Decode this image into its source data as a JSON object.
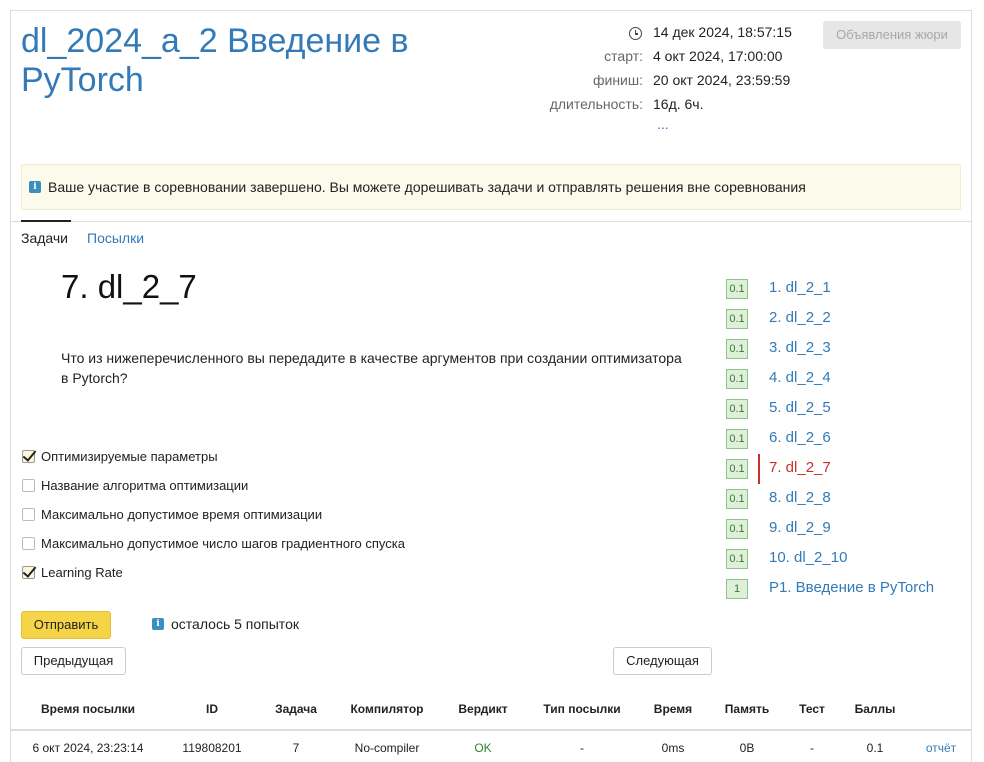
{
  "header": {
    "title": "dl_2024_a_2 Введение в PyTorch",
    "jury_button": "Объявления жюри",
    "meta": {
      "current_time": "14 дек 2024, 18:57:15",
      "start_label": "старт:",
      "start_value": "4 окт 2024, 17:00:00",
      "finish_label": "финиш:",
      "finish_value": "20 окт 2024, 23:59:59",
      "duration_label": "длительность:",
      "duration_value": "16д. 6ч.",
      "more": "..."
    }
  },
  "alert": {
    "text": "Ваше участие в соревновании завершено. Вы можете дорешивать задачи и отправлять решения вне соревнования"
  },
  "tabs": [
    {
      "label": "Задачи",
      "active": true
    },
    {
      "label": "Посылки",
      "active": false
    }
  ],
  "problem": {
    "title": "7. dl_2_7",
    "statement": "Что из нижеперечисленного вы передадите в качестве аргументов при создании оптимизатора в Pytorch?",
    "options": [
      {
        "label": "Оптимизируемые параметры",
        "checked": true
      },
      {
        "label": "Название алгоритма оптимизации",
        "checked": false
      },
      {
        "label": "Максимально допустимое время оптимизации",
        "checked": false
      },
      {
        "label": "Максимально допустимое число шагов градиентного спуска",
        "checked": false
      },
      {
        "label": "Learning Rate",
        "checked": true
      }
    ],
    "submit_label": "Отправить",
    "attempts_text": "осталось 5 попыток",
    "prev_label": "Предыдущая",
    "next_label": "Следующая"
  },
  "task_list": [
    {
      "score": "0.1",
      "label": "1. dl_2_1",
      "active": false
    },
    {
      "score": "0.1",
      "label": "2. dl_2_2",
      "active": false
    },
    {
      "score": "0.1",
      "label": "3. dl_2_3",
      "active": false
    },
    {
      "score": "0.1",
      "label": "4. dl_2_4",
      "active": false
    },
    {
      "score": "0.1",
      "label": "5. dl_2_5",
      "active": false
    },
    {
      "score": "0.1",
      "label": "6. dl_2_6",
      "active": false
    },
    {
      "score": "0.1",
      "label": "7. dl_2_7",
      "active": true
    },
    {
      "score": "0.1",
      "label": "8. dl_2_8",
      "active": false
    },
    {
      "score": "0.1",
      "label": "9. dl_2_9",
      "active": false
    },
    {
      "score": "0.1",
      "label": "10. dl_2_10",
      "active": false
    },
    {
      "score": "1",
      "label": "P1. Введение в PyTorch",
      "active": false
    }
  ],
  "submissions": {
    "columns": [
      "Время посылки",
      "ID",
      "Задача",
      "Компилятор",
      "Вердикт",
      "Тип посылки",
      "Время",
      "Память",
      "Тест",
      "Баллы"
    ],
    "rows": [
      [
        "6 окт 2024, 23:23:14",
        "119808201",
        "7",
        "No-compiler",
        "OK",
        "-",
        "0ms",
        "0B",
        "-",
        "0.1",
        "отчёт"
      ]
    ]
  },
  "colors": {
    "link": "#337ab7",
    "active_task": "#c9302c",
    "submit": "#f5d547",
    "verdict_ok": "#2b8a2b",
    "badge_bg": "#dff0d8"
  }
}
